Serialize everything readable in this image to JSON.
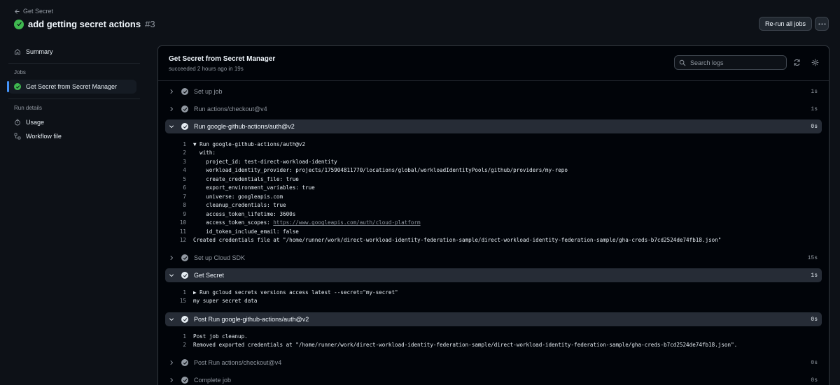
{
  "header": {
    "back_label": "Get Secret",
    "title": "add getting secret actions",
    "run_number": "#3",
    "rerun_label": "Re-run all jobs"
  },
  "sidebar": {
    "summary_label": "Summary",
    "jobs_heading": "Jobs",
    "job_label": "Get Secret from Secret Manager",
    "run_details_heading": "Run details",
    "usage_label": "Usage",
    "workflow_file_label": "Workflow file"
  },
  "job": {
    "title": "Get Secret from Secret Manager",
    "subtitle": "succeeded 2 hours ago in 19s",
    "search_placeholder": "Search logs"
  },
  "steps": [
    {
      "name": "Set up job",
      "duration": "1s",
      "expanded": false
    },
    {
      "name": "Run actions/checkout@v4",
      "duration": "1s",
      "expanded": false
    },
    {
      "name": "Run google-github-actions/auth@v2",
      "duration": "0s",
      "expanded": true
    },
    {
      "name": "Set up Cloud SDK",
      "duration": "15s",
      "expanded": false
    },
    {
      "name": "Get Secret",
      "duration": "1s",
      "expanded": true
    },
    {
      "name": "Post Run google-github-actions/auth@v2",
      "duration": "0s",
      "expanded": true
    },
    {
      "name": "Post Run actions/checkout@v4",
      "duration": "0s",
      "expanded": false
    },
    {
      "name": "Complete job",
      "duration": "0s",
      "expanded": false
    }
  ],
  "logs_auth": [
    {
      "n": "1",
      "text": "▼ Run google-github-actions/auth@v2"
    },
    {
      "n": "2",
      "text": "  with:"
    },
    {
      "n": "3",
      "text": "    project_id: test-direct-workload-identity"
    },
    {
      "n": "4",
      "text": "    workload_identity_provider: projects/175904811770/locations/global/workloadIdentityPools/github/providers/my-repo"
    },
    {
      "n": "5",
      "text": "    create_credentials_file: true"
    },
    {
      "n": "6",
      "text": "    export_environment_variables: true"
    },
    {
      "n": "7",
      "text": "    universe: googleapis.com"
    },
    {
      "n": "8",
      "text": "    cleanup_credentials: true"
    },
    {
      "n": "9",
      "text": "    access_token_lifetime: 3600s"
    },
    {
      "n": "10",
      "text": "    access_token_scopes: ",
      "link": "https://www.googleapis.com/auth/cloud-platform"
    },
    {
      "n": "11",
      "text": "    id_token_include_email: false"
    },
    {
      "n": "12",
      "text": "Created credentials file at \"/home/runner/work/direct-workload-identity-federation-sample/direct-workload-identity-federation-sample/gha-creds-b7cd2524de74fb18.json\""
    }
  ],
  "logs_secret": [
    {
      "n": "1",
      "text": "▶ Run gcloud secrets versions access latest --secret=\"my-secret\""
    },
    {
      "n": "15",
      "text": "my super secret data"
    }
  ],
  "logs_post": [
    {
      "n": "1",
      "text": "Post job cleanup."
    },
    {
      "n": "2",
      "text": "Removed exported credentials at \"/home/runner/work/direct-workload-identity-federation-sample/direct-workload-identity-federation-sample/gha-creds-b7cd2524de74fb18.json\"."
    }
  ],
  "colors": {
    "background": "#0d1117",
    "panel": "#010409",
    "success": "#3fb950",
    "accent": "#4493f8"
  }
}
